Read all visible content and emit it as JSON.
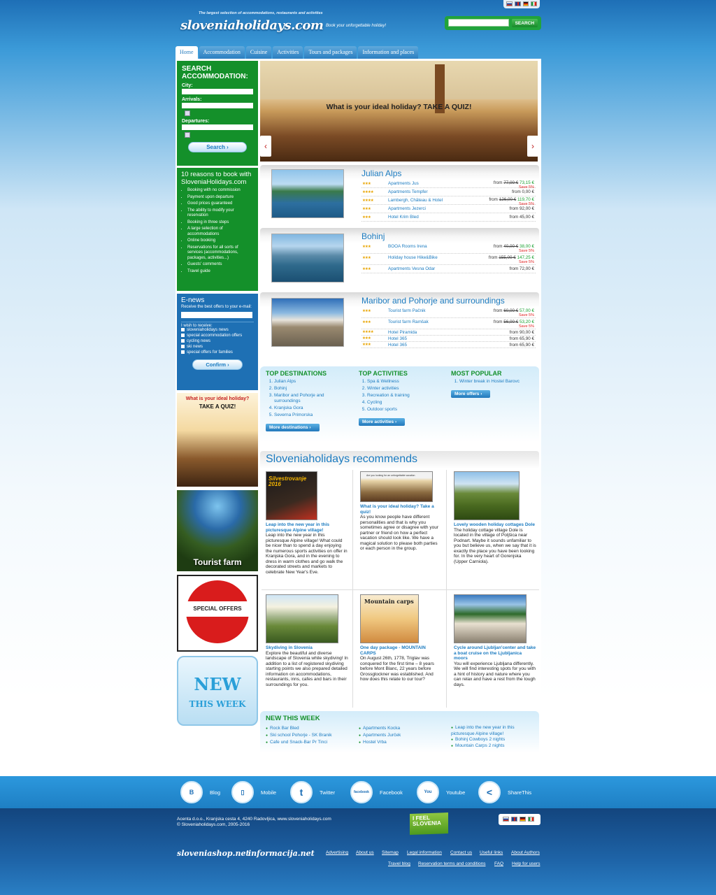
{
  "header": {
    "tagline": "The largest selection of accommodations, restaurants and activities",
    "logo_text_1": "slovenia",
    "logo_text_2": "holidays.com",
    "slogan": "Book your unforgettable holiday!",
    "search_button": "SEARCH"
  },
  "languages": [
    "si",
    "en",
    "de",
    "it"
  ],
  "nav": [
    "Home",
    "Accommodation",
    "Cuisine",
    "Activities",
    "Tours and packages",
    "Information and places"
  ],
  "sidebar": {
    "search": {
      "title": "SEARCH ACCOMMODATION:",
      "city_label": "City:",
      "arrivals_label": "Arrivals:",
      "departures_label": "Departures:",
      "button": "Search"
    },
    "reasons": {
      "title": "10 reasons to book with SloveniaHolidays.com",
      "items": [
        "Booking with no commission",
        "Payment upon departure",
        "Good prices guaranteed",
        "The ability to modify your reservation",
        "Booking in three steps",
        "A large selection of accommodations",
        "Online booking",
        "Reservations for all sorts of services (accommodations, packages, activities...)",
        "Guests' comments",
        "Travel guide"
      ]
    },
    "enews": {
      "title": "E-news",
      "desc": "Receive the best offers to your e-mail:",
      "wish": "I wish to receive:",
      "options": [
        "sloveniaholidays news",
        "special accommodation offers",
        "cycling news",
        "ski news",
        "special offers for families"
      ],
      "button": "Confirm"
    },
    "banners": {
      "quiz_1": "What is your ideal holiday?",
      "quiz_2": "TAKE A QUIZ!",
      "farm": "Tourist farm",
      "special": "SPECIAL OFFERS",
      "new_1": "NEW",
      "new_2": "THIS WEEK"
    }
  },
  "slider": {
    "caption": "What is your ideal holiday? TAKE A QUIZ!"
  },
  "destinations": [
    {
      "title": "Julian Alps",
      "rows": [
        {
          "stars": "★★★",
          "name": "Apartments Jus",
          "old": "77,00 €",
          "price": "73,15 €",
          "save": "Save 5%"
        },
        {
          "stars": "★★★★",
          "name": "Apartments Tempfer",
          "old": "",
          "price": "0,00 €",
          "save": ""
        },
        {
          "stars": "★★★★",
          "name": "Lambergh, Château & Hotel",
          "old": "126,00 €",
          "price": "119,70 €",
          "save": "Save 5%"
        },
        {
          "stars": "★★★",
          "name": "Apartments Jezerci",
          "old": "",
          "price": "92,00 €",
          "save": ""
        },
        {
          "stars": "★★★",
          "name": "Hotel Krim Bled",
          "old": "",
          "price": "45,00 €",
          "save": ""
        }
      ]
    },
    {
      "title": "Bohinj",
      "rows": [
        {
          "stars": "★★★",
          "name": "BOOA Rooms Irena",
          "old": "40,00 €",
          "price": "38,00 €",
          "save": "Save 5%"
        },
        {
          "stars": "★★★",
          "name": "Holiday house Hike&Bike",
          "old": "155,00 €",
          "price": "147,25 €",
          "save": "Save 5%"
        },
        {
          "stars": "★★★",
          "name": "Apartments Vesna Odar",
          "old": "",
          "price": "72,00 €",
          "save": ""
        }
      ]
    },
    {
      "title": "Maribor and Pohorje and surroundings",
      "rows": [
        {
          "stars": "★★★",
          "name": "Tourist farm Pačnik",
          "old": "60,00 €",
          "price": "57,00 €",
          "save": "Save 5%"
        },
        {
          "stars": "★★★",
          "name": "Tourist farm Ramšak",
          "old": "56,00 €",
          "price": "53,20 €",
          "save": "Save 5%"
        },
        {
          "stars": "★★★★",
          "name": "Hotel Piramida",
          "old": "",
          "price": "90,00 €",
          "save": ""
        },
        {
          "stars": "★★★",
          "name": "Hotel 365",
          "old": "",
          "price": "65,90 €",
          "save": ""
        },
        {
          "stars": "★★★",
          "name": "Hotel 365",
          "old": "",
          "price": "65,90 €",
          "save": ""
        }
      ]
    }
  ],
  "from_label": "from",
  "top": {
    "destinations": {
      "title": "TOP DESTINATIONS",
      "items": [
        "Julian Alps",
        "Bohinj",
        "Maribor and Pohorje and surroundings",
        "Kranjska Gora",
        "Severna Primorska"
      ],
      "button": "More destinations"
    },
    "activities": {
      "title": "TOP ACTIVITIES",
      "items": [
        "Spa & Wellness",
        "Winter activities",
        "Recreation & training",
        "Cycling",
        "Outdoor sports"
      ],
      "button": "More activities"
    },
    "popular": {
      "title": "MOST POPULAR",
      "items": [
        "Winter break in Hostel Barovc"
      ],
      "button": "More offers"
    }
  },
  "recommends": {
    "title": "Sloveniaholidays recommends",
    "cards": [
      {
        "img_text": "Silvestrovanje 2016",
        "title": "Leap into the new year in this picturesque Alpine village!",
        "text": "Leap into the new year in this picturesque Alpine village! What could be nicer than to spend a day enjoying the numerous sports activities on offer in Kranjska Gora, and in the evening to dress in warm clothes and go walk the decorated streets and markets to celebrate New Year's Eve."
      },
      {
        "img_text": "Are you looking for an unforgettable vacation",
        "title": "What is your ideal holiday? Take a quiz!",
        "text": "As you know people have different personalities and that is why you sometimes agree or disagree with your partner or friend on how a perfect vacation should look like. We have a magical solution to please both parties or each person in the group."
      },
      {
        "img_text": "",
        "title": "Lovely wooden holiday cottages Dole",
        "text": "The holiday cottage village Dole is located in the village of Poljšica near Podnart. Maybe it sounds unfamiliar to you but believe us, when we say that it is exactly the place you have been looking for. In the very heart of Gorenjska (Upper Carniola)."
      },
      {
        "img_text": "",
        "title": "Skydiving in Slovenia",
        "text": "Explore the beautiful and diverse landscape of Slovenia while skydiving! In addition to a list of registered skydiving starting points we also prepared detailed information on accommodations, restaurants, inns, cafes and bars in their surroundings for you."
      },
      {
        "img_text": "Mountain carps",
        "title": "One day package - MOUNTAIN CARPS",
        "text": "On August 26th, 1778, Triglav was conquered for the first time – 8 years before Mont Blanc, 22 years before Grossglockner was established. And how does this relate to our tour?"
      },
      {
        "img_text": "",
        "title": "Cycle around Ljubljan'center and take a boat cruise on the Ljubljanica moors",
        "text": "You will experience Ljubljana differently. We will find interesting spots for you with a hint of history and nature where you can relax and have a rest from the tough days."
      }
    ]
  },
  "new_this_week": {
    "title": "NEW THIS WEEK",
    "col1": [
      "Rock Bar Bled",
      "Ski school Pohorje - SK Branik",
      "Cafe und Snack-Bar Pr Tinci"
    ],
    "col2": [
      "Apartments Kocka",
      "Apartments Jurček",
      "Hostel Vrba"
    ],
    "col3": [
      "Leap into the new year in this picturesque Alpine village!",
      "Bohinj Cowboys 2 nights",
      "Mountain Carps 2 nights"
    ]
  },
  "social": [
    {
      "icon": "blogger-icon",
      "glyph": "B",
      "label": "Blog"
    },
    {
      "icon": "mobile-icon",
      "glyph": "▯",
      "label": "Mobile"
    },
    {
      "icon": "twitter-icon",
      "glyph": "t",
      "label": "Twitter"
    },
    {
      "icon": "facebook-icon",
      "glyph": "facebook",
      "label": "Facebook"
    },
    {
      "icon": "youtube-icon",
      "glyph": "You",
      "label": "Youtube"
    },
    {
      "icon": "share-icon",
      "glyph": "<",
      "label": "ShareThis"
    }
  ],
  "footer": {
    "address": "Acenta d.o.o., Kranjska cesta 4, 4240 Radovljica, www.sloveniaholidays.com",
    "copyright": "© Sloveniaholidays.com, 2005-2016",
    "ifeel_1": "I FEEL",
    "ifeel_2": "SLOVENIA",
    "brand1": "sloveniashop.net",
    "brand2": "informacija.net",
    "links1": [
      "Advertising",
      "About us",
      "Sitemap",
      "Legal information",
      "Contact us",
      "Useful links",
      "About Authors"
    ],
    "links2": [
      "Travel blog",
      "Reservation terms and conditions",
      "FAQ",
      "Help for users"
    ]
  }
}
